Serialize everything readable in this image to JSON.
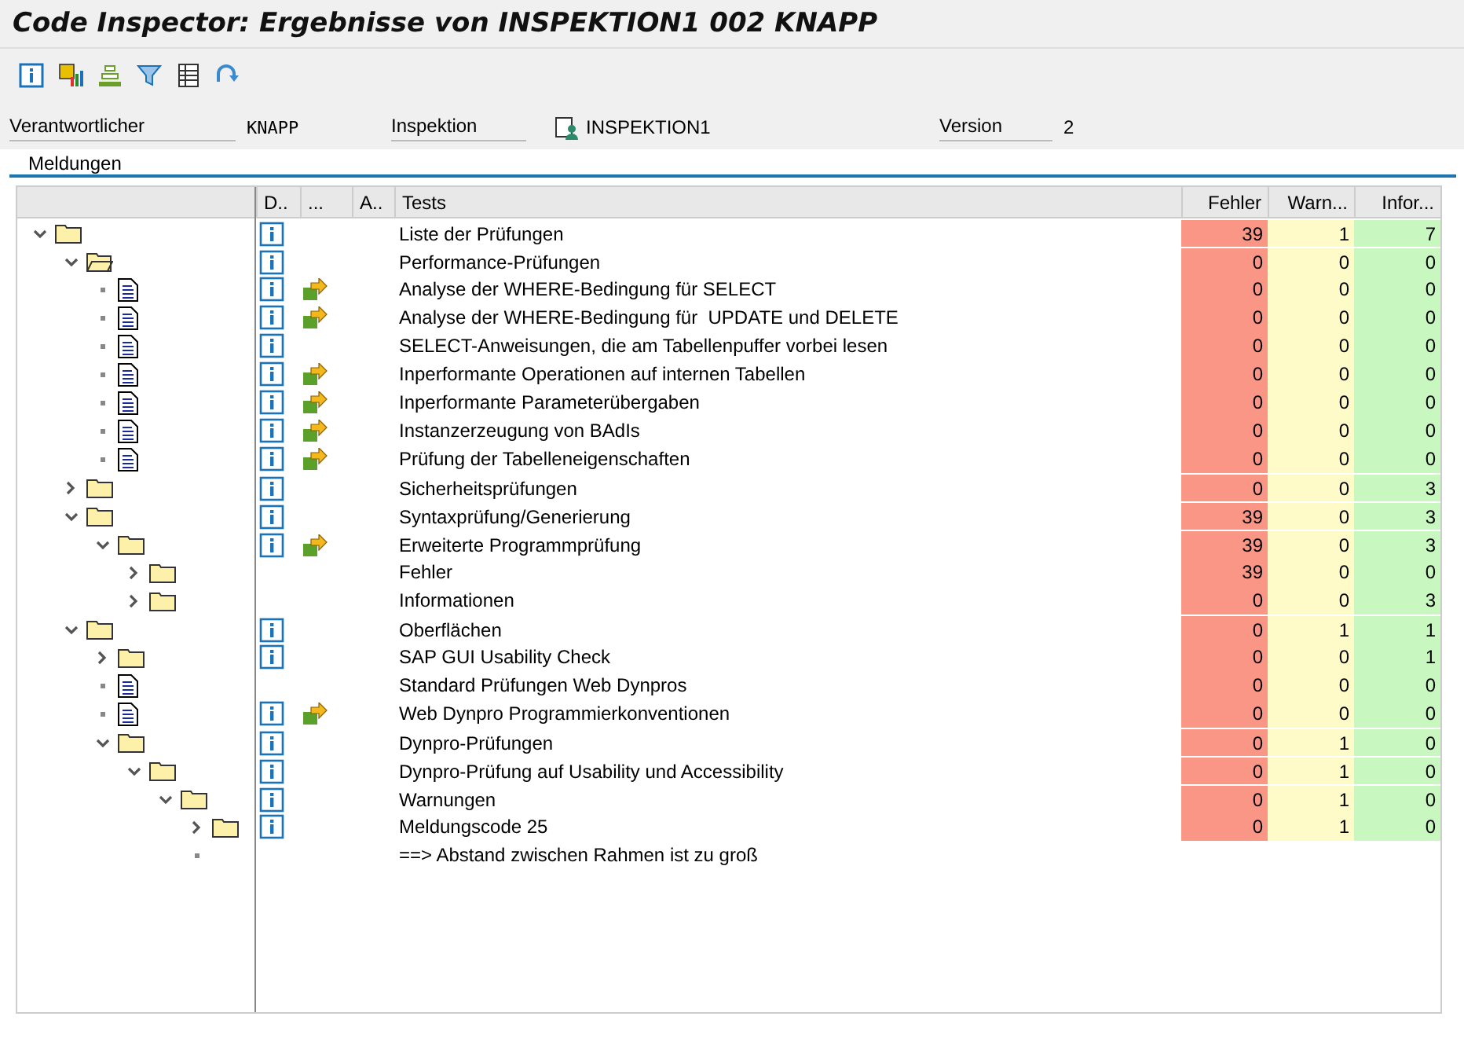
{
  "window": {
    "title": "Code Inspector: Ergebnisse von INSPEKTION1 002 KNAPP"
  },
  "toolbar": [
    {
      "kind": "info"
    },
    {
      "kind": "chart"
    },
    {
      "kind": "stack"
    },
    {
      "kind": "filter"
    },
    {
      "kind": "table"
    },
    {
      "kind": "refresh"
    }
  ],
  "header_fields": [
    {
      "label": "Verantwortlicher",
      "value": "KNAPP",
      "kind": "text"
    },
    {
      "label": "Inspektion",
      "value": "INSPEKTION1",
      "kind": "object"
    },
    {
      "label": "Version",
      "value": "2",
      "kind": "text"
    }
  ],
  "tab": {
    "label": "Meldungen"
  },
  "table": {
    "columns": [
      "D..",
      "...",
      "A..",
      "Tests",
      "Fehler",
      "Warn...",
      "Infor..."
    ],
    "rows": [
      {
        "kind": "folder",
        "expanded": true,
        "info": true,
        "action": false,
        "label": "Liste der Prüfungen",
        "errors": "39",
        "warnings": "1",
        "infos": "7",
        "children": [
          {
            "kind": "open-folder",
            "expanded": true,
            "info": true,
            "action": false,
            "label": "Performance-Prüfungen",
            "errors": "0",
            "warnings": "0",
            "infos": "0",
            "children": [
              {
                "kind": "document",
                "info": true,
                "action": true,
                "label": "Analyse der WHERE-Bedingung für SELECT",
                "errors": "0",
                "warnings": "0",
                "infos": "0"
              },
              {
                "kind": "document",
                "info": true,
                "action": true,
                "label": "Analyse der WHERE-Bedingung für  UPDATE und DELETE",
                "errors": "0",
                "warnings": "0",
                "infos": "0"
              },
              {
                "kind": "document",
                "info": true,
                "action": false,
                "label": "SELECT-Anweisungen, die am Tabellenpuffer vorbei lesen",
                "errors": "0",
                "warnings": "0",
                "infos": "0"
              },
              {
                "kind": "document",
                "info": true,
                "action": true,
                "label": "Inperformante Operationen auf internen Tabellen",
                "errors": "0",
                "warnings": "0",
                "infos": "0"
              },
              {
                "kind": "document",
                "info": true,
                "action": true,
                "label": "Inperformante Parameterübergaben",
                "errors": "0",
                "warnings": "0",
                "infos": "0"
              },
              {
                "kind": "document",
                "info": true,
                "action": true,
                "label": "Instanzerzeugung von BAdIs",
                "errors": "0",
                "warnings": "0",
                "infos": "0"
              },
              {
                "kind": "document",
                "info": true,
                "action": true,
                "label": "Prüfung der Tabelleneigenschaften",
                "errors": "0",
                "warnings": "0",
                "infos": "0"
              }
            ]
          },
          {
            "kind": "folder",
            "expanded": false,
            "info": true,
            "action": false,
            "label": "Sicherheitsprüfungen",
            "errors": "0",
            "warnings": "0",
            "infos": "3"
          },
          {
            "kind": "folder",
            "expanded": true,
            "info": true,
            "action": false,
            "label": "Syntaxprüfung/Generierung",
            "errors": "39",
            "warnings": "0",
            "infos": "3",
            "children": [
              {
                "kind": "folder",
                "expanded": true,
                "info": true,
                "action": true,
                "label": "Erweiterte Programmprüfung",
                "errors": "39",
                "warnings": "0",
                "infos": "3",
                "children": [
                  {
                    "kind": "folder",
                    "expanded": false,
                    "info": false,
                    "action": false,
                    "label": "Fehler",
                    "errors": "39",
                    "warnings": "0",
                    "infos": "0"
                  },
                  {
                    "kind": "folder",
                    "expanded": false,
                    "info": false,
                    "action": false,
                    "label": "Informationen",
                    "errors": "0",
                    "warnings": "0",
                    "infos": "3"
                  }
                ]
              }
            ]
          },
          {
            "kind": "folder",
            "expanded": true,
            "info": true,
            "action": false,
            "label": "Oberflächen",
            "errors": "0",
            "warnings": "1",
            "infos": "1",
            "children": [
              {
                "kind": "folder",
                "expanded": false,
                "info": true,
                "action": false,
                "label": "SAP GUI Usability Check",
                "errors": "0",
                "warnings": "0",
                "infos": "1"
              },
              {
                "kind": "document",
                "info": false,
                "action": false,
                "label": "Standard Prüfungen Web Dynpros",
                "errors": "0",
                "warnings": "0",
                "infos": "0"
              },
              {
                "kind": "document",
                "info": true,
                "action": true,
                "label": "Web Dynpro Programmierkonventionen",
                "errors": "0",
                "warnings": "0",
                "infos": "0"
              },
              {
                "kind": "folder",
                "expanded": true,
                "info": true,
                "action": false,
                "label": "Dynpro-Prüfungen",
                "errors": "0",
                "warnings": "1",
                "infos": "0",
                "children": [
                  {
                    "kind": "folder",
                    "expanded": true,
                    "info": true,
                    "action": false,
                    "label": "Dynpro-Prüfung auf Usability und Accessibility",
                    "errors": "0",
                    "warnings": "1",
                    "infos": "0",
                    "children": [
                      {
                        "kind": "folder",
                        "expanded": true,
                        "info": true,
                        "action": false,
                        "label": "Warnungen",
                        "errors": "0",
                        "warnings": "1",
                        "infos": "0",
                        "children": [
                          {
                            "kind": "folder",
                            "expanded": false,
                            "info": true,
                            "action": false,
                            "label": "Meldungscode 25",
                            "errors": "0",
                            "warnings": "1",
                            "infos": "0"
                          },
                          {
                            "kind": "leaf",
                            "info": false,
                            "action": false,
                            "label": "==> Abstand zwischen Rahmen ist zu groß"
                          }
                        ]
                      }
                    ]
                  }
                ]
              }
            ]
          }
        ]
      }
    ]
  }
}
